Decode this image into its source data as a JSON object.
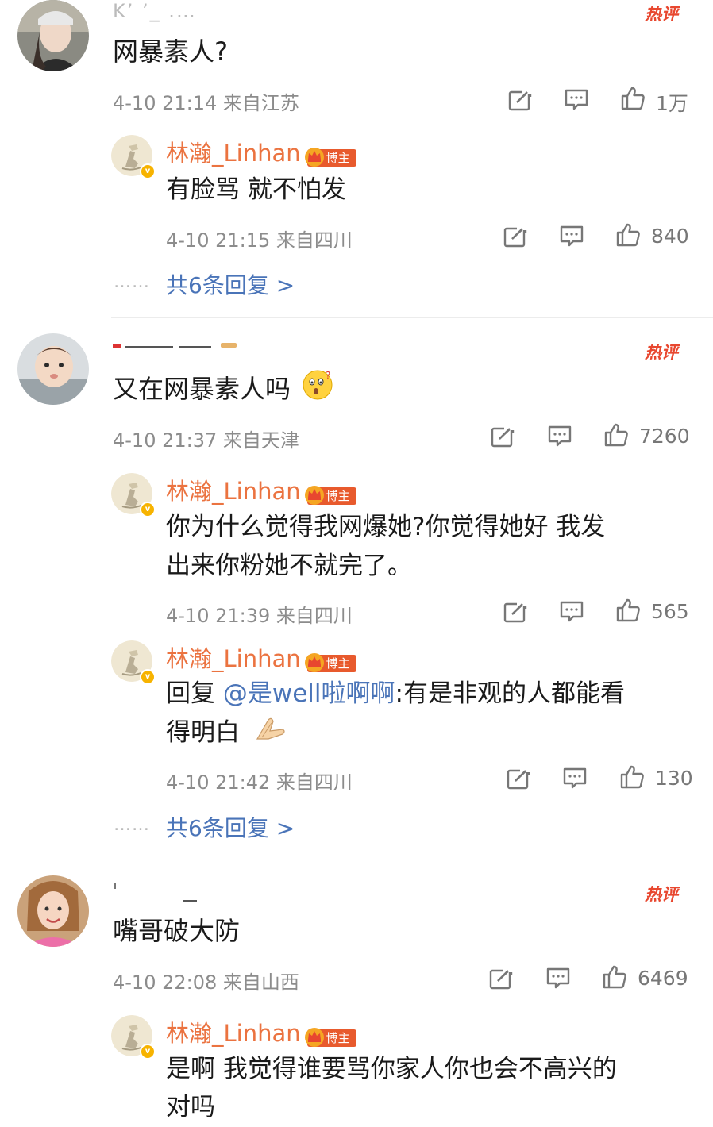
{
  "hot_label": "热评",
  "blogger_name": "林瀚_Linhan",
  "blogger_badge": "博主",
  "comments": [
    {
      "username_masked": "K’ ’_ .…",
      "text": "网暴素人?",
      "meta": "4-10 21:14 来自江苏",
      "likes": "1万",
      "replies": [
        {
          "text": "有脸骂 就不怕发",
          "meta": "4-10 21:15 来自四川",
          "likes": "840"
        }
      ],
      "more_replies": "共6条回复 >"
    },
    {
      "username_masked": "",
      "text": "又在网暴素人吗",
      "meta": "4-10 21:37 来自天津",
      "likes": "7260",
      "replies": [
        {
          "text_line1": "你为什么觉得我网爆她?你觉得她好 我发",
          "text_line2": "出来你粉她不就完了。",
          "meta": "4-10 21:39 来自四川",
          "likes": "565"
        },
        {
          "reply_prefix": "回复",
          "mention": "@是well啦啊啊",
          "text_rest": ":有是非观的人都能看",
          "text_line2": "得明白",
          "meta": "4-10 21:42 来自四川",
          "likes": "130"
        }
      ],
      "more_replies": "共6条回复 >"
    },
    {
      "username_masked": "",
      "text": "嘴哥破大防",
      "meta": "4-10 22:08 来自山西",
      "likes": "6469",
      "replies": [
        {
          "text_line1": "是啊 我觉得谁要骂你家人你也会不高兴的",
          "text_line2": "对吗"
        }
      ]
    }
  ],
  "dots": "……"
}
